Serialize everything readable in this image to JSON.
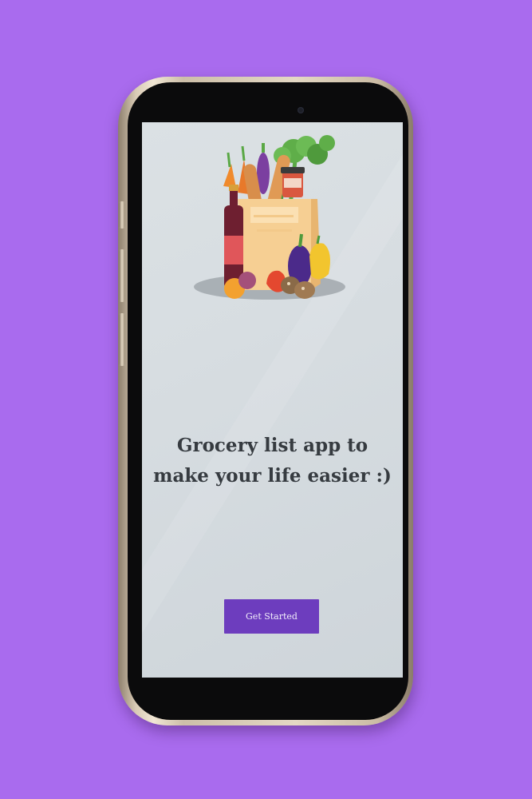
{
  "background_color": "#a96bee",
  "device": {
    "frame_color": "#d9cbb6",
    "bezel_color": "#0b0b0c",
    "screen_color": "#d6dce0"
  },
  "onboarding": {
    "illustration_icon": "grocery-bag-icon",
    "headline_line1": "Grocery list app to",
    "headline_line2": "make your life easier :)",
    "headline_color": "#363b40",
    "cta_label": "Get Started",
    "cta_color": "#6d3dbe"
  }
}
